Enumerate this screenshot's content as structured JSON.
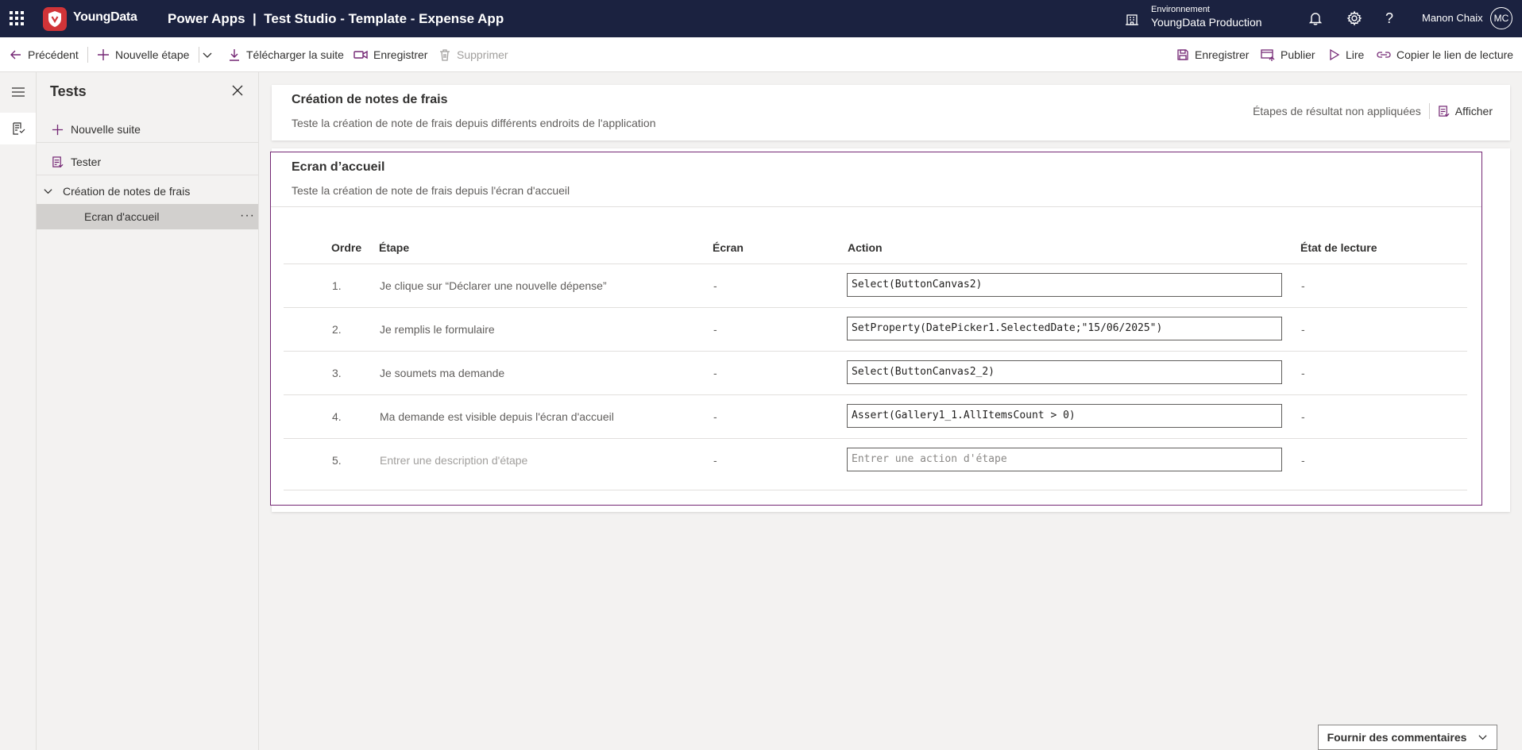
{
  "topbar": {
    "brand_name": "YoungData",
    "app_title": "Power Apps  |  Test Studio - Template - Expense App",
    "environment_label": "Environnement",
    "environment_value": "YoungData Production",
    "user_name": "Manon Chaix",
    "user_initials": "MC"
  },
  "commands": {
    "back": "Précédent",
    "new_step": "Nouvelle étape",
    "download_suite": "Télécharger la suite",
    "record": "Enregistrer",
    "delete": "Supprimer",
    "save": "Enregistrer",
    "publish": "Publier",
    "play": "Lire",
    "copy_link": "Copier le lien de lecture"
  },
  "tests_panel": {
    "title": "Tests",
    "new_suite": "Nouvelle suite",
    "test_item": "Tester",
    "suite_name": "Création de notes de frais",
    "case_name": "Ecran d'accueil"
  },
  "suite_header": {
    "title": "Création de notes de frais",
    "description": "Teste la création de note de frais depuis différents endroits de l'application",
    "result_steps_status": "Étapes de résultat non appliquées",
    "show_label": "Afficher"
  },
  "test_case": {
    "title": "Ecran d’accueil",
    "description": "Teste la création de note de frais depuis l'écran d'accueil"
  },
  "grid": {
    "columns": {
      "order": "Ordre",
      "step": "Étape",
      "screen": "Écran",
      "action": "Action",
      "playback_state": "État de lecture"
    },
    "rows": [
      {
        "order": "1.",
        "step": "Je clique sur “Déclarer une nouvelle dépense”",
        "screen": "-",
        "action": "Select(ButtonCanvas2)",
        "state": "-"
      },
      {
        "order": "2.",
        "step": "Je remplis le formulaire",
        "screen": "-",
        "action": "SetProperty(DatePicker1.SelectedDate;\"15/06/2025\")",
        "state": "-"
      },
      {
        "order": "3.",
        "step": "Je soumets ma demande",
        "screen": "-",
        "action": "Select(ButtonCanvas2_2)",
        "state": "-"
      },
      {
        "order": "4.",
        "step": "Ma demande est visible depuis l'écran d'accueil",
        "screen": "-",
        "action": "Assert(Gallery1_1.AllItemsCount > 0)",
        "state": "-"
      }
    ],
    "new_row": {
      "order": "5.",
      "step_placeholder": "Entrer une description d'étape",
      "screen": "-",
      "action_placeholder": "Entrer une action d'étape",
      "state": "-"
    }
  },
  "feedback": {
    "label": "Fournir des commentaires"
  },
  "colors": {
    "topbar_bg": "#1b2240",
    "accent": "#742774",
    "brand_red": "#d13438"
  }
}
